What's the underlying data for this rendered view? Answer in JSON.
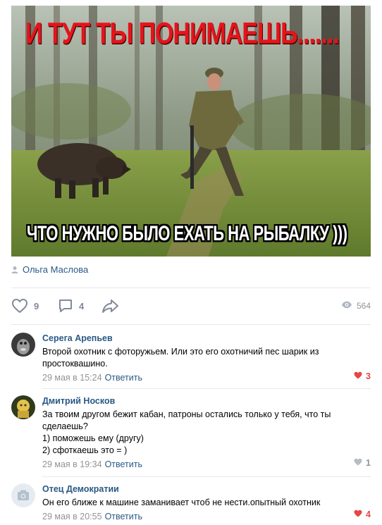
{
  "post": {
    "image": {
      "top_caption": "И ТУТ ТЫ ПОНИМАЕШЬ.......",
      "bottom_caption": "ЧТО НУЖНО БЫЛО ЕХАТЬ НА РЫБАЛКУ )))"
    },
    "author": "Ольга Маслова",
    "likes": "9",
    "comments": "4",
    "views": "564"
  },
  "comments": [
    {
      "name": "Серега Арепьев",
      "text": "Второй охотник с фоторужьем. Или это его охотничий пес шарик из простоквашино.",
      "time": "29 мая в 15:24",
      "reply": "Ответить",
      "likes": "3",
      "liked": true
    },
    {
      "name": "Дмитрий Носков",
      "text": "За твоим другом бежит кабан, патроны остались только у тебя, что ты сделаешь?\n1) поможешь ему (другу)\n2) сфоткаешь это = )",
      "time": "29 мая в 19:34",
      "reply": "Ответить",
      "likes": "1",
      "liked": false
    },
    {
      "name": "Отец Демократии",
      "text": "Он его ближе к машине заманивает чтоб не нести.опытный охотник",
      "time": "29 мая в 20:55",
      "reply": "Ответить",
      "likes": "4",
      "liked": true
    }
  ],
  "colors": {
    "link": "#2a5885",
    "meta": "#939393",
    "like_active": "#e64646",
    "action_icon": "#828a99",
    "meme_red": "#e5141b"
  },
  "icons": {
    "author": "user-icon",
    "like": "heart-icon",
    "comment": "comment-bubble-icon",
    "share": "share-arrow-icon",
    "views": "eye-icon"
  }
}
